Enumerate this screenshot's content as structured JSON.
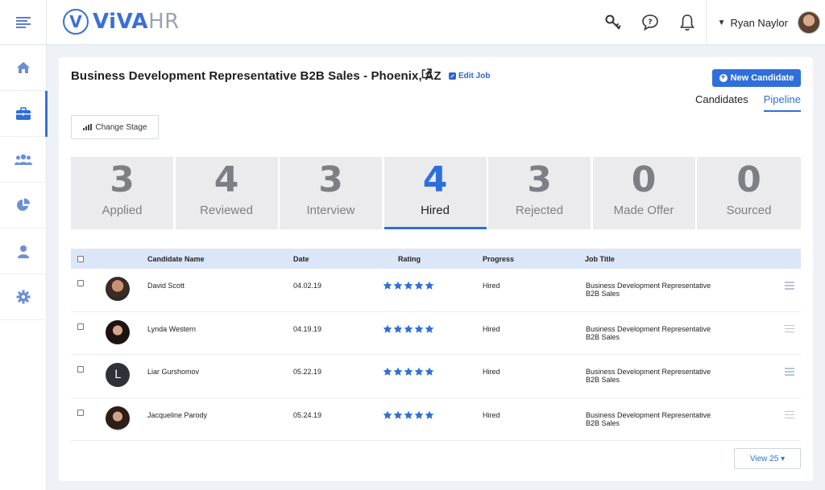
{
  "app": {
    "brand_part1": "ViVA",
    "brand_part2": "HR",
    "user_name": "Ryan Naylor"
  },
  "sidebar": {
    "items": [
      {
        "icon": "home-icon"
      },
      {
        "icon": "briefcase-icon",
        "active": true
      },
      {
        "icon": "users-icon"
      },
      {
        "icon": "pie-chart-icon"
      },
      {
        "icon": "person-icon"
      },
      {
        "icon": "gear-icon"
      }
    ]
  },
  "job": {
    "title": "Business Development Representative B2B Sales - Phoenix, AZ",
    "edit_label": "Edit Job",
    "new_candidate_label": "New Candidate",
    "change_stage_label": "Change Stage"
  },
  "view_tabs": [
    {
      "label": "Candidates",
      "active": false
    },
    {
      "label": "Pipeline",
      "active": true
    }
  ],
  "stages": [
    {
      "count": "3",
      "label": "Applied"
    },
    {
      "count": "4",
      "label": "Reviewed"
    },
    {
      "count": "3",
      "label": "Interview"
    },
    {
      "count": "4",
      "label": "Hired",
      "active": true
    },
    {
      "count": "3",
      "label": "Rejected"
    },
    {
      "count": "0",
      "label": "Made Offer"
    },
    {
      "count": "0",
      "label": "Sourced"
    }
  ],
  "table": {
    "headers": {
      "name": "Candidate Name",
      "date": "Date",
      "rating": "Rating",
      "progress": "Progress",
      "job_title": "Job Title"
    },
    "rows": [
      {
        "name": "David Scott",
        "date": "04.02.19",
        "rating": 5,
        "progress": "Hired",
        "job_line1": "Business Development Representative",
        "job_line2": "B2B Sales"
      },
      {
        "name": "Lynda Western",
        "date": "04.19.19",
        "rating": 5,
        "progress": "Hired",
        "job_line1": "Business Development Representative",
        "job_line2": "B2B Sales"
      },
      {
        "name": "Liar Gurshomov",
        "date": "05.22.19",
        "rating": 5,
        "progress": "Hired",
        "job_line1": "Business Development Representative",
        "job_line2": "B2B Sales",
        "avatar_initial": "L"
      },
      {
        "name": "Jacqueline Parody",
        "date": "05.24.19",
        "rating": 5,
        "progress": "Hired",
        "job_line1": "Business Development Representative",
        "job_line2": "B2B Sales"
      }
    ]
  },
  "pagination": {
    "view_label": "View 25 ▾"
  },
  "colors": {
    "accent": "#2f6fdc",
    "header_row": "#dce6f9",
    "tile_bg": "#ebebed"
  }
}
